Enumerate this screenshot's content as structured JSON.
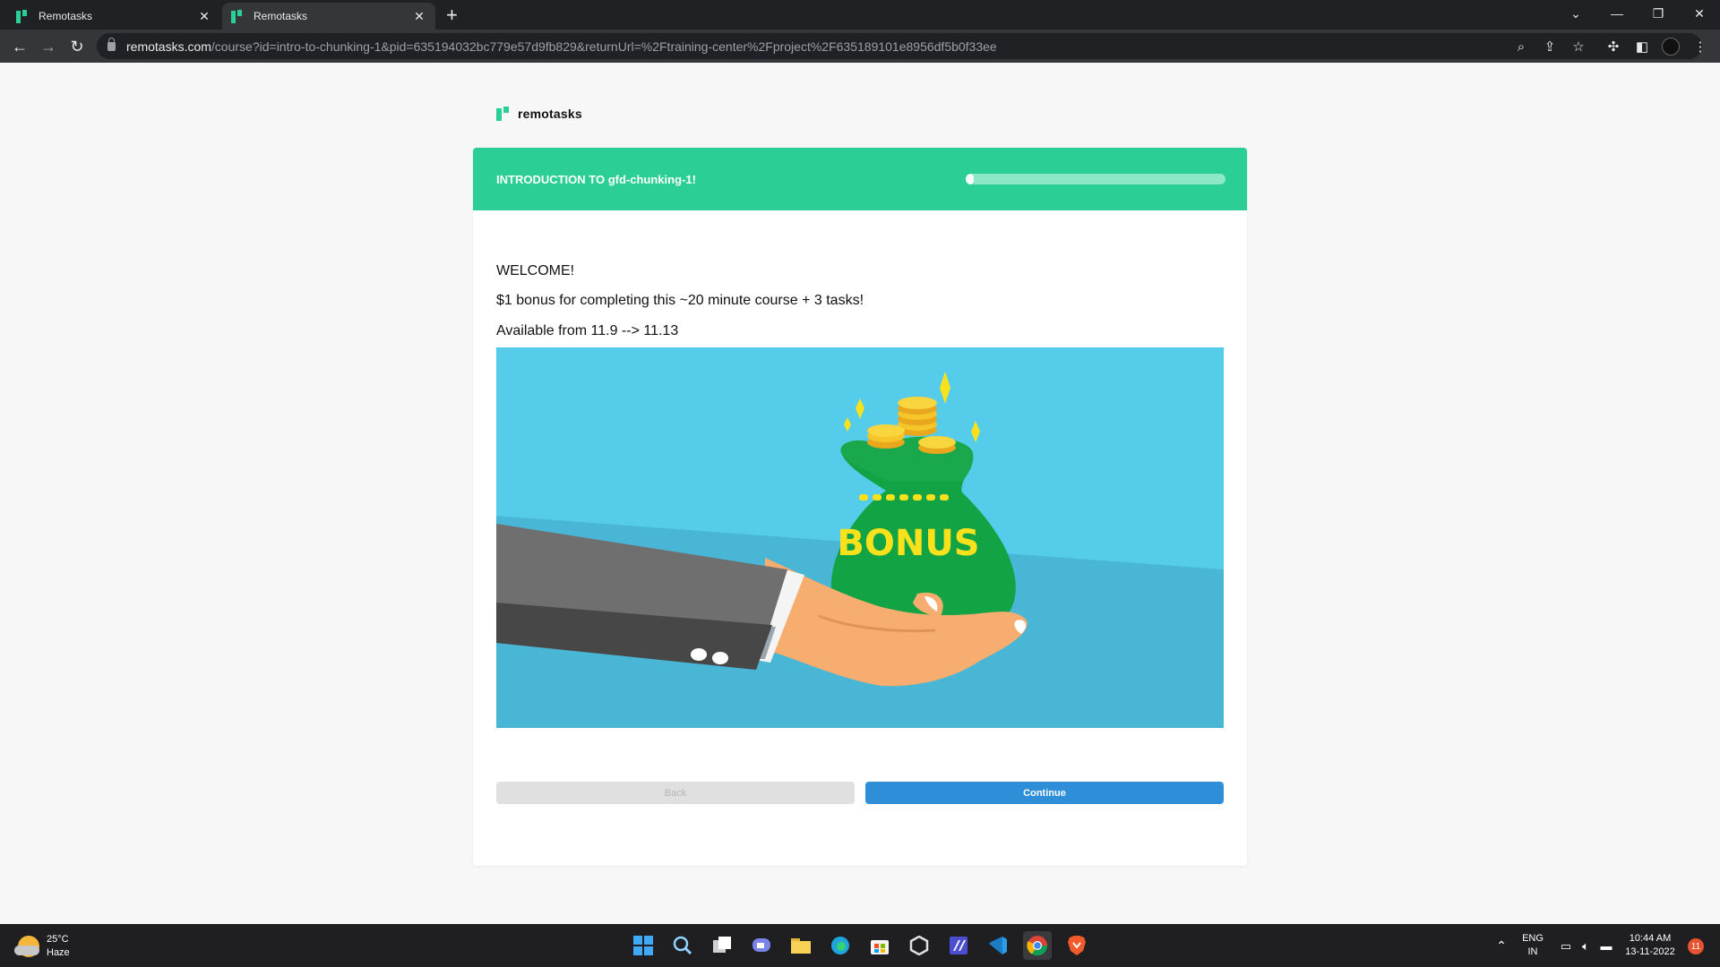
{
  "browser": {
    "tabs": [
      {
        "title": "Remotasks",
        "active": false
      },
      {
        "title": "Remotasks",
        "active": true
      }
    ],
    "url_domain": "remotasks.com",
    "url_path": "/course?id=intro-to-chunking-1&pid=635194032bc779e57d9fb829&returnUrl=%2Ftraining-center%2Fproject%2F635189101e8956df5b0f33ee"
  },
  "page": {
    "logo_text": "remotasks",
    "course_title": "INTRODUCTION TO gfd-chunking-1!",
    "progress_fraction": 0.03,
    "lines": [
      "WELCOME!",
      "$1 bonus for completing this ~20 minute course + 3 tasks!",
      "Available from 11.9 --> 11.13"
    ],
    "image_text": "BONUS",
    "back_label": "Back",
    "continue_label": "Continue"
  },
  "colors": {
    "brand_green": "#2bcf95",
    "continue_blue": "#2e8fd8",
    "bonus_yellow": "#f9e21b"
  },
  "taskbar": {
    "temperature": "25°C",
    "weather": "Haze",
    "lang_top": "ENG",
    "lang_bottom": "IN",
    "time": "10:44 AM",
    "date": "13-11-2022",
    "notification_count": "11"
  }
}
